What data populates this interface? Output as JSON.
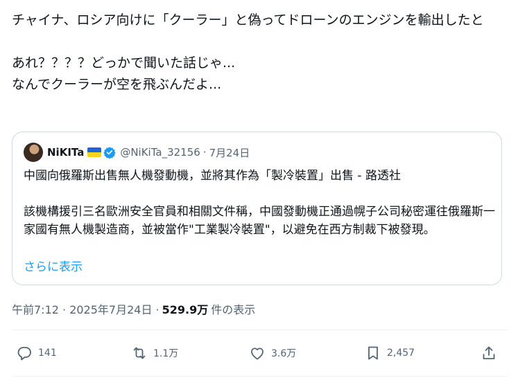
{
  "tweet": {
    "text": "チャイナ、ロシア向けに「クーラー」と偽ってドローンのエンジンを輸出したと\n\nあれ？？？？どっかで聞いた話じゃ...\nなんでクーラーが空を飛ぶんだよ..."
  },
  "quote": {
    "name": "NiKITa",
    "handle": "@NiKiTa_32156",
    "separator": "·",
    "date": "7月24日",
    "body": "中國向俄羅斯出售無人機發動機，並將其作為「製冷裝置」出售 - 路透社\n\n該機構援引三名歐洲安全官員和相關文件稱，中國發動機正通過幌子公司秘密運往俄羅斯一家國有無人機製造商，並被當作\"工業製冷裝置\"，以避免在西方制裁下被發現。",
    "show_more": "さらに表示"
  },
  "meta": {
    "timestamp": "午前7:12 · 2025年7月24日 ·",
    "views_count": "529.9万",
    "views_label": "件の表示"
  },
  "actions": {
    "replies": "141",
    "reposts": "1.1万",
    "likes": "3.6万",
    "bookmarks": "2,457"
  },
  "colors": {
    "link": "#1d9bf0",
    "muted": "#536471",
    "border": "#cfd9de",
    "verified": "#1d9bf0"
  },
  "icons": [
    "reply-icon",
    "repost-icon",
    "like-icon",
    "bookmark-icon",
    "share-icon",
    "verified-badge-icon",
    "ukraine-flag-icon"
  ]
}
